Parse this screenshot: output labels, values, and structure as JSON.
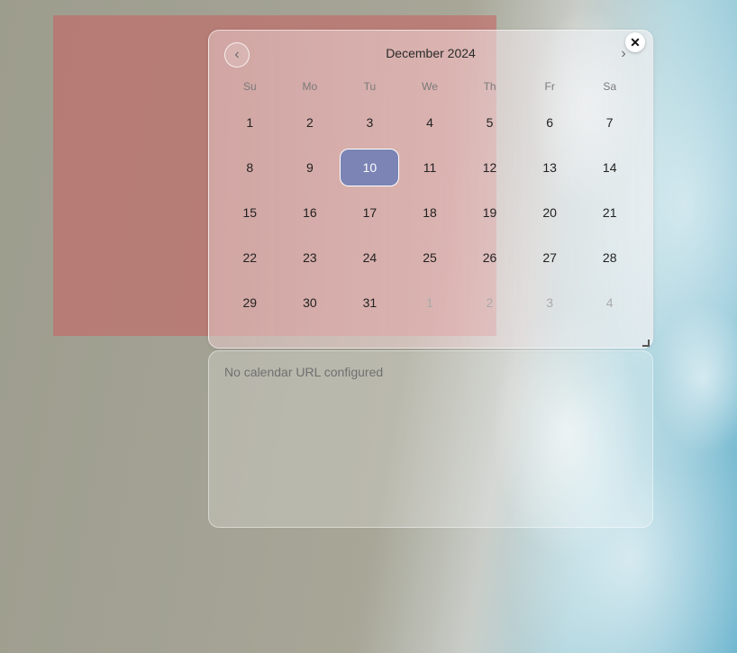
{
  "calendar": {
    "title": "December 2024",
    "prev_icon": "chevron-left-icon",
    "next_icon": "chevron-right-icon",
    "close_icon": "close-icon",
    "weekdays": [
      "Su",
      "Mo",
      "Tu",
      "We",
      "Th",
      "Fr",
      "Sa"
    ],
    "days": [
      "1",
      "2",
      "3",
      "4",
      "5",
      "6",
      "7",
      "8",
      "9",
      "10",
      "11",
      "12",
      "13",
      "14",
      "15",
      "16",
      "17",
      "18",
      "19",
      "20",
      "21",
      "22",
      "23",
      "24",
      "25",
      "26",
      "27",
      "28",
      "29",
      "30",
      "31",
      "1",
      "2",
      "3",
      "4"
    ],
    "selected_day": "10",
    "selected_color": "#7b84b4"
  },
  "events": {
    "message": "No calendar URL configured"
  }
}
